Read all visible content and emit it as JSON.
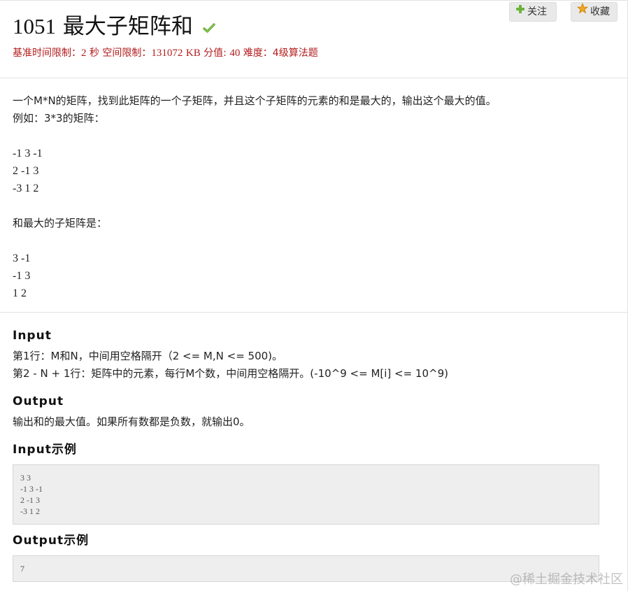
{
  "problem": {
    "number": "1051",
    "title": "最大子矩阵和",
    "solved_icon": "check-icon",
    "accent_color": "#b31c1c"
  },
  "meta": {
    "time_label": "基准时间限制：",
    "time_value": "2",
    "time_unit": "秒",
    "space_label": "空间限制：",
    "space_value": "131072",
    "space_unit": "KB",
    "score_label": "分值:",
    "score_value": "40",
    "difficulty_label": "难度：",
    "difficulty_value": "4级算法题"
  },
  "actions": {
    "follow_label": "关注",
    "follow_icon": "plus-icon",
    "collect_label": "收藏",
    "collect_icon": "star-icon"
  },
  "description": {
    "lines": [
      "一个M*N的矩阵，找到此矩阵的一个子矩阵，并且这个子矩阵的元素的和是最大的，输出这个最大的值。",
      "例如：3*3的矩阵：",
      "",
      "-1 3 -1",
      "2 -1 3",
      "-3 1 2",
      "",
      "和最大的子矩阵是：",
      "",
      "3 -1",
      "-1 3",
      "1 2"
    ]
  },
  "input": {
    "heading": "Input",
    "lines": [
      "第1行：M和N，中间用空格隔开（2 <= M,N <= 500)。",
      "第2 - N + 1行：矩阵中的元素，每行M个数，中间用空格隔开。(-10^9 <= M[i] <= 10^9)"
    ]
  },
  "output": {
    "heading": "Output",
    "lines": [
      "输出和的最大值。如果所有数都是负数，就输出0。"
    ]
  },
  "input_example": {
    "heading": "Input示例",
    "lines": [
      "3 3",
      "-1 3 -1",
      "2 -1 3",
      "-3 1 2"
    ]
  },
  "output_example": {
    "heading": "Output示例",
    "lines": [
      "7"
    ]
  },
  "watermark": "@稀土掘金技术社区"
}
